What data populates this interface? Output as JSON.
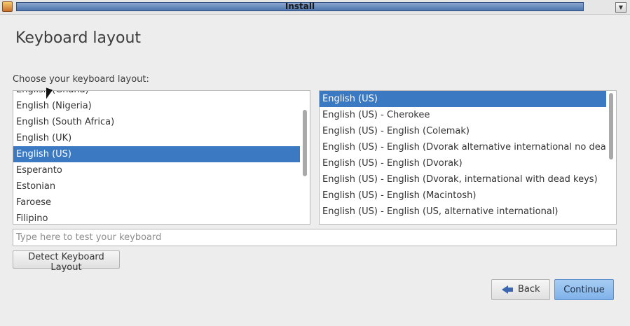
{
  "window": {
    "title": "Install",
    "menu_glyph": "▼"
  },
  "page": {
    "heading": "Keyboard layout",
    "choose_label": "Choose your keyboard layout:"
  },
  "layout_list": {
    "items": [
      "English (Ghana)",
      "English (Nigeria)",
      "English (South Africa)",
      "English (UK)",
      "English (US)",
      "Esperanto",
      "Estonian",
      "Faroese",
      "Filipino"
    ],
    "selected": "English (US)"
  },
  "variant_list": {
    "items": [
      "English (US)",
      "English (US) - Cherokee",
      "English (US) - English (Colemak)",
      "English (US) - English (Dvorak alternative international no dead keys)",
      "English (US) - English (Dvorak)",
      "English (US) - English (Dvorak, international with dead keys)",
      "English (US) - English (Macintosh)",
      "English (US) - English (US, alternative international)"
    ],
    "selected": "English (US)"
  },
  "test_field": {
    "value": "",
    "placeholder": "Type here to test your keyboard"
  },
  "buttons": {
    "detect": "Detect Keyboard Layout",
    "back": "Back",
    "continue": "Continue"
  },
  "colors": {
    "selection": "#3c79c3",
    "continue_button": "#8dbdf0"
  },
  "icons": {
    "app": "installer-icon",
    "menu": "chevron-down-icon",
    "back": "arrow-left-icon"
  }
}
